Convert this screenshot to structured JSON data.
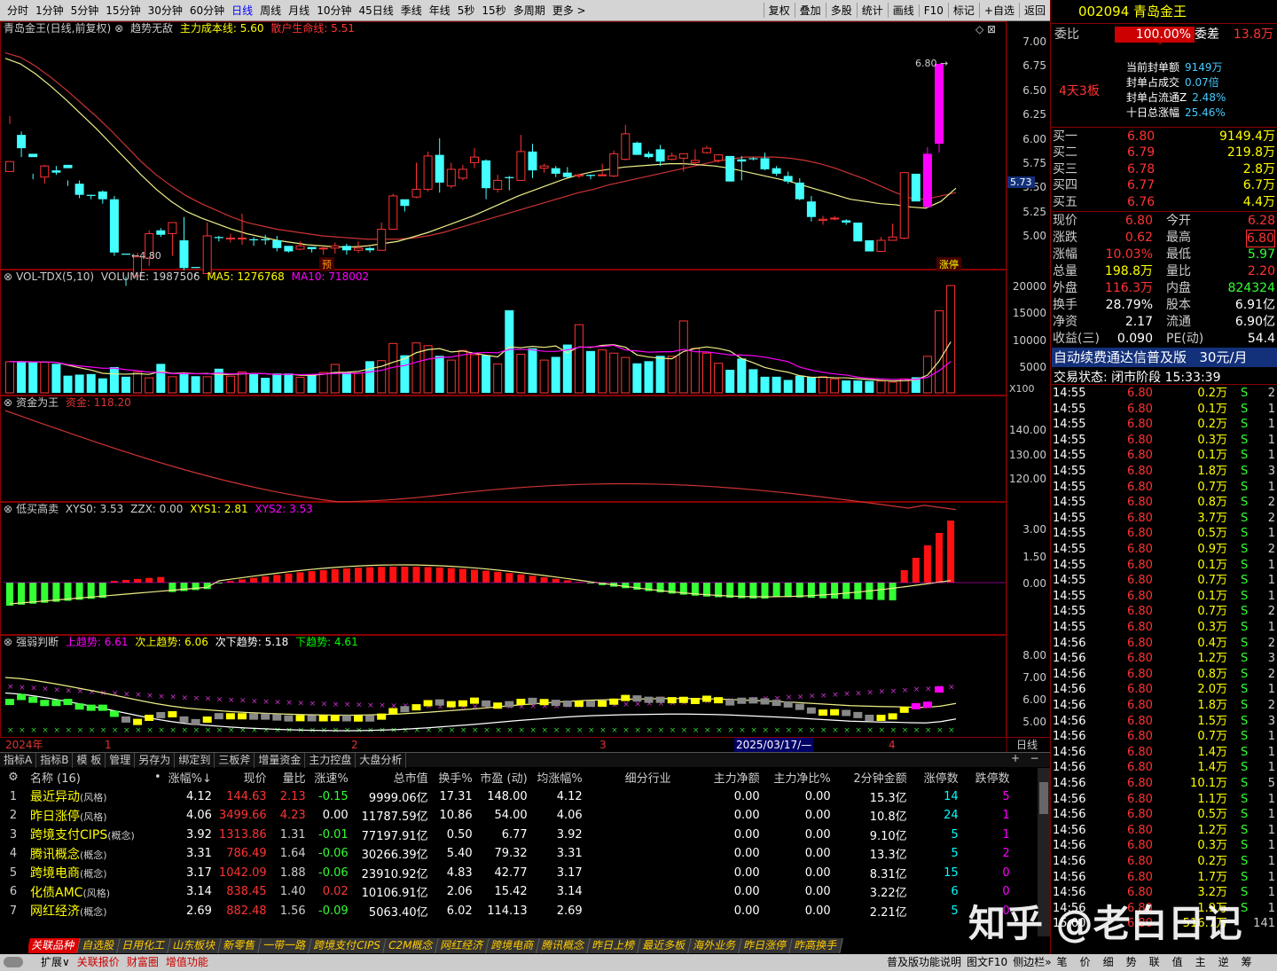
{
  "toolbar": {
    "periods": [
      "分时",
      "1分钟",
      "5分钟",
      "15分钟",
      "30分钟",
      "60分钟",
      "日线",
      "周线",
      "月线",
      "10分钟",
      "45日线",
      "季线",
      "年线",
      "5秒",
      "15秒",
      "多周期",
      "更多 >"
    ],
    "active": "日线",
    "right": [
      "复权",
      "叠加",
      "多股",
      "统计",
      "画线",
      "F10",
      "标记",
      "+自选",
      "返回"
    ]
  },
  "kline": {
    "title": "青岛金王(日线,前复权)",
    "indicator": "趋势无敌",
    "l1": "主力成本线: 5.60",
    "l2": "散户生命线: 5.51",
    "yticks": [
      "7.00",
      "6.75",
      "6.50",
      "6.25",
      "6.00",
      "5.75",
      "5.50",
      "5.25",
      "5.00"
    ],
    "price_tag": "5.73",
    "high_label": "6.80",
    "low_label": "4.80",
    "tag_yu": "预",
    "tag_zt": "涨停",
    "candles": [
      [
        5.83,
        5.92,
        6.26,
        6.33
      ],
      [
        6.16,
        6.04,
        6.19,
        5.96
      ],
      [
        5.99,
        5.96,
        5.81,
        5.76
      ],
      [
        5.78,
        5.88,
        5.89,
        5.72
      ],
      [
        5.84,
        5.82,
        5.88,
        5.8
      ],
      [
        5.89,
        5.86,
        5.75,
        5.7
      ],
      [
        5.72,
        5.62,
        5.75,
        5.59
      ],
      [
        5.62,
        5.61,
        5.62,
        5.58
      ],
      [
        5.65,
        5.58,
        5.66,
        5.54
      ],
      [
        5.58,
        5.1,
        5.61,
        5.07
      ],
      [
        5.09,
        5.08,
        4.88,
        4.8
      ],
      [
        4.89,
        5.06,
        5.1,
        4.86
      ],
      [
        5.05,
        5.27,
        5.3,
        4.98
      ],
      [
        5.3,
        5.26,
        5.32,
        5.24
      ],
      [
        5.27,
        5.37,
        5.37,
        5.07
      ],
      [
        5.21,
        4.96,
        5.42,
        4.94
      ],
      [
        4.97,
        4.96,
        4.91,
        4.89
      ],
      [
        4.91,
        5.25,
        5.37,
        4.92
      ],
      [
        5.24,
        5.23,
        5.25,
        5.2
      ],
      [
        5.23,
        5.23,
        5.27,
        5.19
      ],
      [
        5.23,
        5.23,
        5.45,
        5.17
      ],
      [
        5.22,
        5.21,
        5.24,
        5.16
      ],
      [
        5.22,
        5.21,
        5.26,
        5.17
      ],
      [
        5.21,
        5.14,
        5.25,
        5.11
      ],
      [
        5.16,
        5.11,
        5.15,
        5.1
      ],
      [
        5.13,
        5.16,
        5.2,
        5.12
      ],
      [
        5.15,
        5.13,
        5.15,
        5.1
      ],
      [
        5.14,
        5.14,
        5.17,
        5.08
      ],
      [
        5.14,
        5.16,
        5.19,
        5.09
      ],
      [
        5.16,
        5.12,
        5.18,
        5.08
      ],
      [
        5.12,
        5.14,
        5.2,
        5.1
      ],
      [
        5.14,
        5.12,
        5.15,
        5.1
      ],
      [
        5.12,
        5.31,
        5.37,
        5.13
      ],
      [
        5.31,
        5.61,
        5.63,
        5.31
      ],
      [
        5.58,
        5.52,
        5.57,
        5.47
      ],
      [
        5.6,
        5.67,
        5.91,
        5.59
      ],
      [
        5.67,
        5.97,
        6.01,
        5.65
      ],
      [
        5.98,
        5.73,
        6.13,
        5.64
      ],
      [
        5.7,
        5.85,
        5.91,
        5.68
      ],
      [
        5.77,
        5.85,
        5.89,
        5.75
      ],
      [
        5.91,
        5.96,
        6.04,
        5.86
      ],
      [
        5.93,
        5.68,
        5.94,
        5.58
      ],
      [
        5.67,
        5.75,
        5.8,
        5.64
      ],
      [
        5.78,
        5.77,
        5.79,
        5.66
      ],
      [
        5.75,
        6.01,
        6.16,
        5.76
      ],
      [
        6.01,
        5.84,
        6.08,
        5.77
      ],
      [
        5.86,
        5.88,
        5.9,
        5.82
      ],
      [
        5.86,
        5.81,
        5.88,
        5.78
      ],
      [
        5.82,
        5.78,
        5.87,
        5.77
      ],
      [
        5.79,
        5.8,
        5.81,
        5.77
      ],
      [
        5.8,
        5.79,
        5.8,
        5.76
      ],
      [
        5.8,
        5.8,
        5.9,
        5.8
      ],
      [
        5.79,
        5.99,
        6.02,
        5.78
      ],
      [
        5.94,
        6.17,
        6.25,
        5.93
      ],
      [
        6.09,
        5.98,
        6.1,
        5.98
      ],
      [
        5.99,
        5.96,
        6.01,
        5.95
      ],
      [
        6.03,
        5.92,
        6.07,
        5.88
      ],
      [
        5.94,
        5.97,
        6.0,
        5.93
      ],
      [
        5.95,
        5.99,
        5.99,
        5.83
      ],
      [
        5.91,
        5.93,
        6.03,
        5.88
      ],
      [
        6.0,
        6.04,
        6.06,
        5.99
      ],
      [
        5.93,
        5.98,
        5.98,
        5.91
      ],
      [
        5.97,
        5.74,
        5.92,
        5.74
      ],
      [
        5.94,
        5.92,
        5.97,
        5.75
      ],
      [
        5.95,
        5.94,
        5.96,
        5.93
      ],
      [
        5.95,
        5.85,
        6.0,
        5.84
      ],
      [
        5.86,
        5.81,
        5.88,
        5.79
      ],
      [
        5.79,
        5.74,
        5.83,
        5.72
      ],
      [
        5.73,
        5.58,
        5.77,
        5.57
      ],
      [
        5.56,
        5.42,
        5.61,
        5.38
      ],
      [
        5.39,
        5.4,
        5.43,
        5.35
      ],
      [
        5.41,
        5.41,
        5.43,
        5.39
      ],
      [
        5.39,
        5.37,
        5.4,
        5.35
      ],
      [
        5.37,
        5.2,
        5.34,
        5.21
      ],
      [
        5.21,
        5.11,
        5.21,
        5.12
      ],
      [
        5.11,
        5.21,
        5.24,
        5.14
      ],
      [
        5.21,
        5.24,
        5.36,
        5.22
      ],
      [
        5.23,
        5.82,
        5.8,
        5.22
      ],
      [
        5.81,
        5.56,
        5.68,
        5.58
      ],
      [
        5.51,
        5.99,
        6.05,
        5.5
      ],
      [
        6.08,
        6.8,
        6.8,
        6.0
      ]
    ],
    "ma_red": [
      6.9,
      6.86,
      6.78,
      6.68,
      6.57,
      6.45,
      6.33,
      6.2,
      6.06,
      5.92,
      5.8,
      5.7,
      5.61,
      5.54,
      5.48,
      5.42,
      5.37,
      5.34,
      5.31,
      5.29,
      5.27,
      5.25,
      5.24,
      5.23,
      5.22,
      5.22,
      5.22,
      5.23,
      5.25,
      5.28,
      5.32,
      5.36,
      5.4,
      5.44,
      5.48,
      5.52,
      5.56,
      5.6,
      5.64,
      5.67,
      5.71,
      5.74,
      5.77,
      5.8,
      5.83,
      5.86,
      5.89,
      5.92,
      5.94,
      5.96,
      5.96,
      5.96,
      5.95,
      5.93,
      5.9,
      5.86,
      5.81,
      5.76,
      5.7,
      5.64,
      5.59,
      5.58,
      5.61,
      5.64
    ],
    "ma_yellow": [
      6.85,
      6.8,
      6.71,
      6.6,
      6.48,
      6.35,
      6.22,
      6.08,
      5.94,
      5.8,
      5.67,
      5.56,
      5.47,
      5.41,
      5.36,
      5.31,
      5.27,
      5.24,
      5.21,
      5.19,
      5.17,
      5.16,
      5.15,
      5.15,
      5.16,
      5.18,
      5.2,
      5.24,
      5.28,
      5.33,
      5.38,
      5.43,
      5.49,
      5.55,
      5.61,
      5.66,
      5.71,
      5.76,
      5.8,
      5.83,
      5.85,
      5.87,
      5.88,
      5.89,
      5.9,
      5.9,
      5.89,
      5.88,
      5.86,
      5.83,
      5.8,
      5.77,
      5.74,
      5.7,
      5.66,
      5.62,
      5.58,
      5.56,
      5.54,
      5.53,
      5.51,
      5.5,
      5.56,
      5.68
    ]
  },
  "volume": {
    "title": "VOL-TDX(5,10)",
    "vol": "VOLUME: 1987506",
    "ma5": "MA5: 1276768",
    "ma10": "MA10: 718002",
    "yticks": [
      "20000",
      "15000",
      "10000",
      "5000"
    ],
    "unit": "X100",
    "bars": [
      5.8,
      5.8,
      5.7,
      5.7,
      5.4,
      3.2,
      3.4,
      3.5,
      2.7,
      4.8,
      3.0,
      3.9,
      2.8,
      5.4,
      3.0,
      3.5,
      3.1,
      3.0,
      4.5,
      3.1,
      3.9,
      3.5,
      2.8,
      3.6,
      3.6,
      2.9,
      3.4,
      3.8,
      5.3,
      3.8,
      3.7,
      5.9,
      6.0,
      9.2,
      7.0,
      9.3,
      8.8,
      6.9,
      6.1,
      7.9,
      7.1,
      7.0,
      5.4,
      15.4,
      7.2,
      8.3,
      6.1,
      6.7,
      9.0,
      12.7,
      7.8,
      8.0,
      7.4,
      6.6,
      5.5,
      5.9,
      6.9,
      6.8,
      13.4,
      8.3,
      7.4,
      5.5,
      4.3,
      6.4,
      4.4,
      3.0,
      3.0,
      2.4,
      3.2,
      2.9,
      3.0,
      2.6,
      2.3,
      2.3,
      2.2,
      2.2,
      2.0,
      2.6,
      2.9,
      6.8,
      15.3,
      20.0
    ]
  },
  "capital": {
    "title": "资金为王",
    "label": "资金: 118.20",
    "yticks": [
      "140.00",
      "130.00",
      "120.00"
    ]
  },
  "lowhigh": {
    "title": "低买高卖",
    "xys0": "XYS0: 3.53",
    "zzx": "ZZX: 0.00",
    "xys1": "XYS1: 2.81",
    "xys2": "XYS2: 3.53",
    "yticks": [
      "3.00",
      "1.50",
      "0.00"
    ]
  },
  "strength": {
    "title": "强弱判断",
    "s1": "上趋势: 6.61",
    "s2": "次上趋势: 6.06",
    "s3": "次下趋势: 5.18",
    "s4": "下趋势: 4.61",
    "yticks": [
      "8.00",
      "7.00",
      "6.00",
      "5.00"
    ]
  },
  "timeaxis": {
    "year": "2024年",
    "m1": "1",
    "m2": "2",
    "m3": "3",
    "m4": "4",
    "cursor": "2025/03/17/—",
    "period": "日线"
  },
  "tabs": [
    "指标A",
    "指标B",
    "模 板",
    "管理",
    "另存为",
    "绑定到",
    "三板斧",
    "增量资金",
    "主力控盘",
    "大盘分析"
  ],
  "table": {
    "headers": [
      "名称 (16)",
      "•",
      "涨幅%↓",
      "现价",
      "量比",
      "涨速%",
      "总市值",
      "换手%",
      "市盈 (动)",
      "均涨幅%",
      "细分行业",
      "主力净额",
      "主力净比%",
      "2分钟金额",
      "涨停数",
      "跌停数"
    ],
    "rows": [
      [
        "1",
        "最近异动",
        "(风格)",
        "4.12",
        "144.63",
        "2.13",
        "-0.15",
        "9999.06亿",
        "17.31",
        "148.00",
        "4.12",
        "",
        "0.00",
        "0.00",
        "15.3亿",
        "14",
        "5"
      ],
      [
        "2",
        "昨日涨停",
        "(风格)",
        "4.06",
        "3499.66",
        "4.23",
        "0.00",
        "11787.59亿",
        "10.86",
        "54.00",
        "4.06",
        "",
        "0.00",
        "0.00",
        "10.8亿",
        "24",
        "1"
      ],
      [
        "3",
        "跨境支付CIPS",
        "(概念)",
        "3.92",
        "1313.86",
        "1.31",
        "-0.01",
        "77197.91亿",
        "0.50",
        "6.77",
        "3.92",
        "",
        "0.00",
        "0.00",
        "9.10亿",
        "5",
        "1"
      ],
      [
        "4",
        "腾讯概念",
        "(概念)",
        "3.31",
        "786.49",
        "1.64",
        "-0.06",
        "30266.39亿",
        "5.40",
        "79.32",
        "3.31",
        "",
        "0.00",
        "0.00",
        "13.3亿",
        "5",
        "2"
      ],
      [
        "5",
        "跨境电商",
        "(概念)",
        "3.17",
        "1042.09",
        "1.88",
        "-0.06",
        "23910.92亿",
        "4.83",
        "42.77",
        "3.17",
        "",
        "0.00",
        "0.00",
        "8.31亿",
        "15",
        "0"
      ],
      [
        "6",
        "化债AMC",
        "(风格)",
        "3.14",
        "838.45",
        "1.40",
        "0.02",
        "10106.91亿",
        "2.06",
        "15.42",
        "3.14",
        "",
        "0.00",
        "0.00",
        "3.22亿",
        "6",
        "0"
      ],
      [
        "7",
        "网红经济",
        "(概念)",
        "2.69",
        "882.48",
        "1.56",
        "-0.09",
        "5063.40亿",
        "6.02",
        "114.13",
        "2.69",
        "",
        "0.00",
        "0.00",
        "2.21亿",
        "5",
        "0"
      ]
    ]
  },
  "bottom_tabs": [
    "关联品种",
    "自选股",
    "日用化工",
    "山东板块",
    "新零售",
    "一带一路",
    "跨境支付CIPS",
    "C2M概念",
    "网红经济",
    "跨境电商",
    "腾讯概念",
    "昨日上榜",
    "最近多板",
    "海外业务",
    "昨日涨停",
    "昨高换手"
  ],
  "status": {
    "left": [
      "扩展∨",
      "关联报价",
      "财富圈",
      "增值功能"
    ],
    "right": [
      "普及版功能说明",
      "图文F10",
      "侧边栏»",
      "笔",
      "价",
      "细",
      "势",
      "联",
      "值",
      "主",
      "逆",
      "筹"
    ]
  },
  "watermark": "知乎 @老白日记",
  "quote": {
    "code": "002094",
    "name": "青岛金王",
    "weibi_l": "委比",
    "weibi": "100.00%",
    "weicha_l": "委差",
    "weicha": "13.8万",
    "board": "4天3板",
    "seal": [
      [
        "当前封单额",
        "9149万"
      ],
      [
        "封单占成交",
        "0.07倍"
      ],
      [
        "封单占流通Z",
        "2.48%"
      ],
      [
        "十日总涨幅",
        "25.46%"
      ]
    ],
    "bids": [
      [
        "买一",
        "6.80",
        "9149.4万"
      ],
      [
        "买二",
        "6.79",
        "219.8万"
      ],
      [
        "买三",
        "6.78",
        "2.8万"
      ],
      [
        "买四",
        "6.77",
        "6.7万"
      ],
      [
        "买五",
        "6.76",
        "4.4万"
      ]
    ],
    "stats": [
      [
        "现价",
        "6.80",
        "今开",
        "6.28"
      ],
      [
        "涨跌",
        "0.62",
        "最高",
        "6.80"
      ],
      [
        "涨幅",
        "10.03%",
        "最低",
        "5.97"
      ],
      [
        "总量",
        "198.8万",
        "量比",
        "2.20"
      ],
      [
        "外盘",
        "116.3万",
        "内盘",
        "824324"
      ],
      [
        "换手",
        "28.79%",
        "股本",
        "6.91亿"
      ],
      [
        "净资",
        "2.17",
        "流通",
        "6.90亿"
      ],
      [
        "收益(三)",
        "0.090",
        "PE(动)",
        "54.4"
      ]
    ],
    "ad": "自动续费通达信普及版",
    "ad_price": "30元/月",
    "state": "交易状态: 闭市阶段 15:33:39"
  },
  "ticks": [
    [
      "14:55",
      "6.80",
      "0.2万",
      "S",
      "2"
    ],
    [
      "14:55",
      "6.80",
      "0.1万",
      "S",
      "1"
    ],
    [
      "14:55",
      "6.80",
      "0.2万",
      "S",
      "1"
    ],
    [
      "14:55",
      "6.80",
      "0.3万",
      "S",
      "1"
    ],
    [
      "14:55",
      "6.80",
      "0.1万",
      "S",
      "1"
    ],
    [
      "14:55",
      "6.80",
      "1.8万",
      "S",
      "3"
    ],
    [
      "14:55",
      "6.80",
      "0.7万",
      "S",
      "1"
    ],
    [
      "14:55",
      "6.80",
      "0.8万",
      "S",
      "2"
    ],
    [
      "14:55",
      "6.80",
      "3.7万",
      "S",
      "2"
    ],
    [
      "14:55",
      "6.80",
      "0.5万",
      "S",
      "1"
    ],
    [
      "14:55",
      "6.80",
      "0.9万",
      "S",
      "2"
    ],
    [
      "14:55",
      "6.80",
      "0.1万",
      "S",
      "1"
    ],
    [
      "14:55",
      "6.80",
      "0.7万",
      "S",
      "1"
    ],
    [
      "14:55",
      "6.80",
      "0.1万",
      "S",
      "1"
    ],
    [
      "14:55",
      "6.80",
      "0.7万",
      "S",
      "2"
    ],
    [
      "14:55",
      "6.80",
      "0.3万",
      "S",
      "1"
    ],
    [
      "14:56",
      "6.80",
      "0.4万",
      "S",
      "2"
    ],
    [
      "14:56",
      "6.80",
      "1.2万",
      "S",
      "3"
    ],
    [
      "14:56",
      "6.80",
      "0.8万",
      "S",
      "2"
    ],
    [
      "14:56",
      "6.80",
      "2.0万",
      "S",
      "1"
    ],
    [
      "14:56",
      "6.80",
      "1.8万",
      "S",
      "2"
    ],
    [
      "14:56",
      "6.80",
      "1.5万",
      "S",
      "3"
    ],
    [
      "14:56",
      "6.80",
      "0.7万",
      "S",
      "1"
    ],
    [
      "14:56",
      "6.80",
      "1.4万",
      "S",
      "1"
    ],
    [
      "14:56",
      "6.80",
      "1.4万",
      "S",
      "1"
    ],
    [
      "14:56",
      "6.80",
      "10.1万",
      "S",
      "5"
    ],
    [
      "14:56",
      "6.80",
      "1.1万",
      "S",
      "1"
    ],
    [
      "14:56",
      "6.80",
      "0.5万",
      "S",
      "1"
    ],
    [
      "14:56",
      "6.80",
      "1.2万",
      "S",
      "1"
    ],
    [
      "14:56",
      "6.80",
      "0.3万",
      "S",
      "1"
    ],
    [
      "14:56",
      "6.80",
      "0.2万",
      "S",
      "1"
    ],
    [
      "14:56",
      "6.80",
      "1.7万",
      "S",
      "1"
    ],
    [
      "14:56",
      "6.80",
      "3.2万",
      "S",
      "1"
    ],
    [
      "14:56",
      "6.80",
      "1.9万",
      "S",
      "1"
    ],
    [
      "15:00",
      "6.80",
      "516.7万",
      "",
      "141"
    ]
  ]
}
